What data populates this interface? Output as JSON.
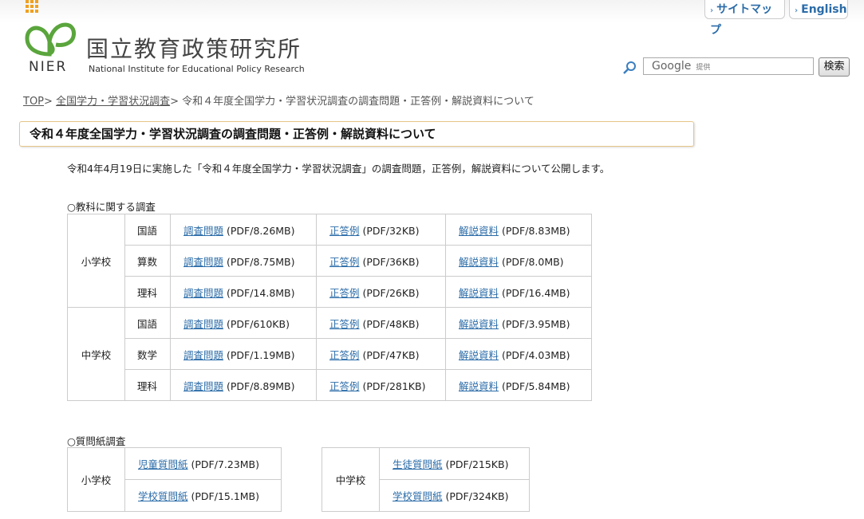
{
  "header": {
    "logo_text": "NIER",
    "org_name_ja": "国立教育政策研究所",
    "org_name_en": "National Institute for Educational Policy Research",
    "nav_links": [
      {
        "label": "サイトマップ"
      },
      {
        "label": "English"
      }
    ],
    "search": {
      "placeholder": "Google",
      "placeholder_sub": "提供",
      "button_label": "検索"
    },
    "brand_colors": {
      "green": "#5aa53c",
      "orange": "#f0a020",
      "link": "#2b6ca8"
    }
  },
  "breadcrumb": {
    "items": [
      {
        "label": "TOP",
        "link": true
      },
      {
        "label": "全国学力・学習状況調査",
        "link": true
      },
      {
        "label": "令和４年度全国学力・学習状況調査の調査問題・正答例・解説資料について",
        "link": false
      }
    ],
    "separator": ">"
  },
  "page": {
    "title": "令和４年度全国学力・学習状況調査の調査問題・正答例・解説資料について",
    "intro": "令和4年4月19日に実施した「令和４年度全国学力・学習状況調査」の調査問題，正答例，解説資料について公開します。"
  },
  "subjects_section": {
    "title": "○教科に関する調査",
    "groups": [
      {
        "school": "小学校",
        "rows": [
          {
            "subject": "国語",
            "problem": {
              "label": "調査問題",
              "size": "(PDF/8.26MB)"
            },
            "answer": {
              "label": "正答例",
              "size": "(PDF/32KB)"
            },
            "commentary": {
              "label": "解説資料",
              "size": "(PDF/8.83MB)"
            }
          },
          {
            "subject": "算数",
            "problem": {
              "label": "調査問題",
              "size": "(PDF/8.75MB)"
            },
            "answer": {
              "label": "正答例",
              "size": "(PDF/36KB)"
            },
            "commentary": {
              "label": "解説資料",
              "size": "(PDF/8.0MB)"
            }
          },
          {
            "subject": "理科",
            "problem": {
              "label": "調査問題",
              "size": "(PDF/14.8MB)"
            },
            "answer": {
              "label": "正答例",
              "size": "(PDF/26KB)"
            },
            "commentary": {
              "label": "解説資料",
              "size": "(PDF/16.4MB)"
            }
          }
        ]
      },
      {
        "school": "中学校",
        "rows": [
          {
            "subject": "国語",
            "problem": {
              "label": "調査問題",
              "size": "(PDF/610KB)"
            },
            "answer": {
              "label": "正答例",
              "size": "(PDF/48KB)"
            },
            "commentary": {
              "label": "解説資料",
              "size": "(PDF/3.95MB)"
            }
          },
          {
            "subject": "数学",
            "problem": {
              "label": "調査問題",
              "size": "(PDF/1.19MB)"
            },
            "answer": {
              "label": "正答例",
              "size": "(PDF/47KB)"
            },
            "commentary": {
              "label": "解説資料",
              "size": "(PDF/4.03MB)"
            }
          },
          {
            "subject": "理科",
            "problem": {
              "label": "調査問題",
              "size": "(PDF/8.89MB)"
            },
            "answer": {
              "label": "正答例",
              "size": "(PDF/281KB)"
            },
            "commentary": {
              "label": "解説資料",
              "size": "(PDF/5.84MB)"
            }
          }
        ]
      }
    ]
  },
  "questionnaire_section": {
    "title": "○質問紙調査",
    "elementary": {
      "school": "小学校",
      "rows": [
        {
          "label": "児童質問紙",
          "size": "(PDF/7.23MB)"
        },
        {
          "label": "学校質問紙",
          "size": "(PDF/15.1MB)"
        }
      ]
    },
    "junior_high": {
      "school": "中学校",
      "rows": [
        {
          "label": "生徒質問紙",
          "size": "(PDF/215KB)"
        },
        {
          "label": "学校質問紙",
          "size": "(PDF/324KB)"
        }
      ]
    }
  }
}
